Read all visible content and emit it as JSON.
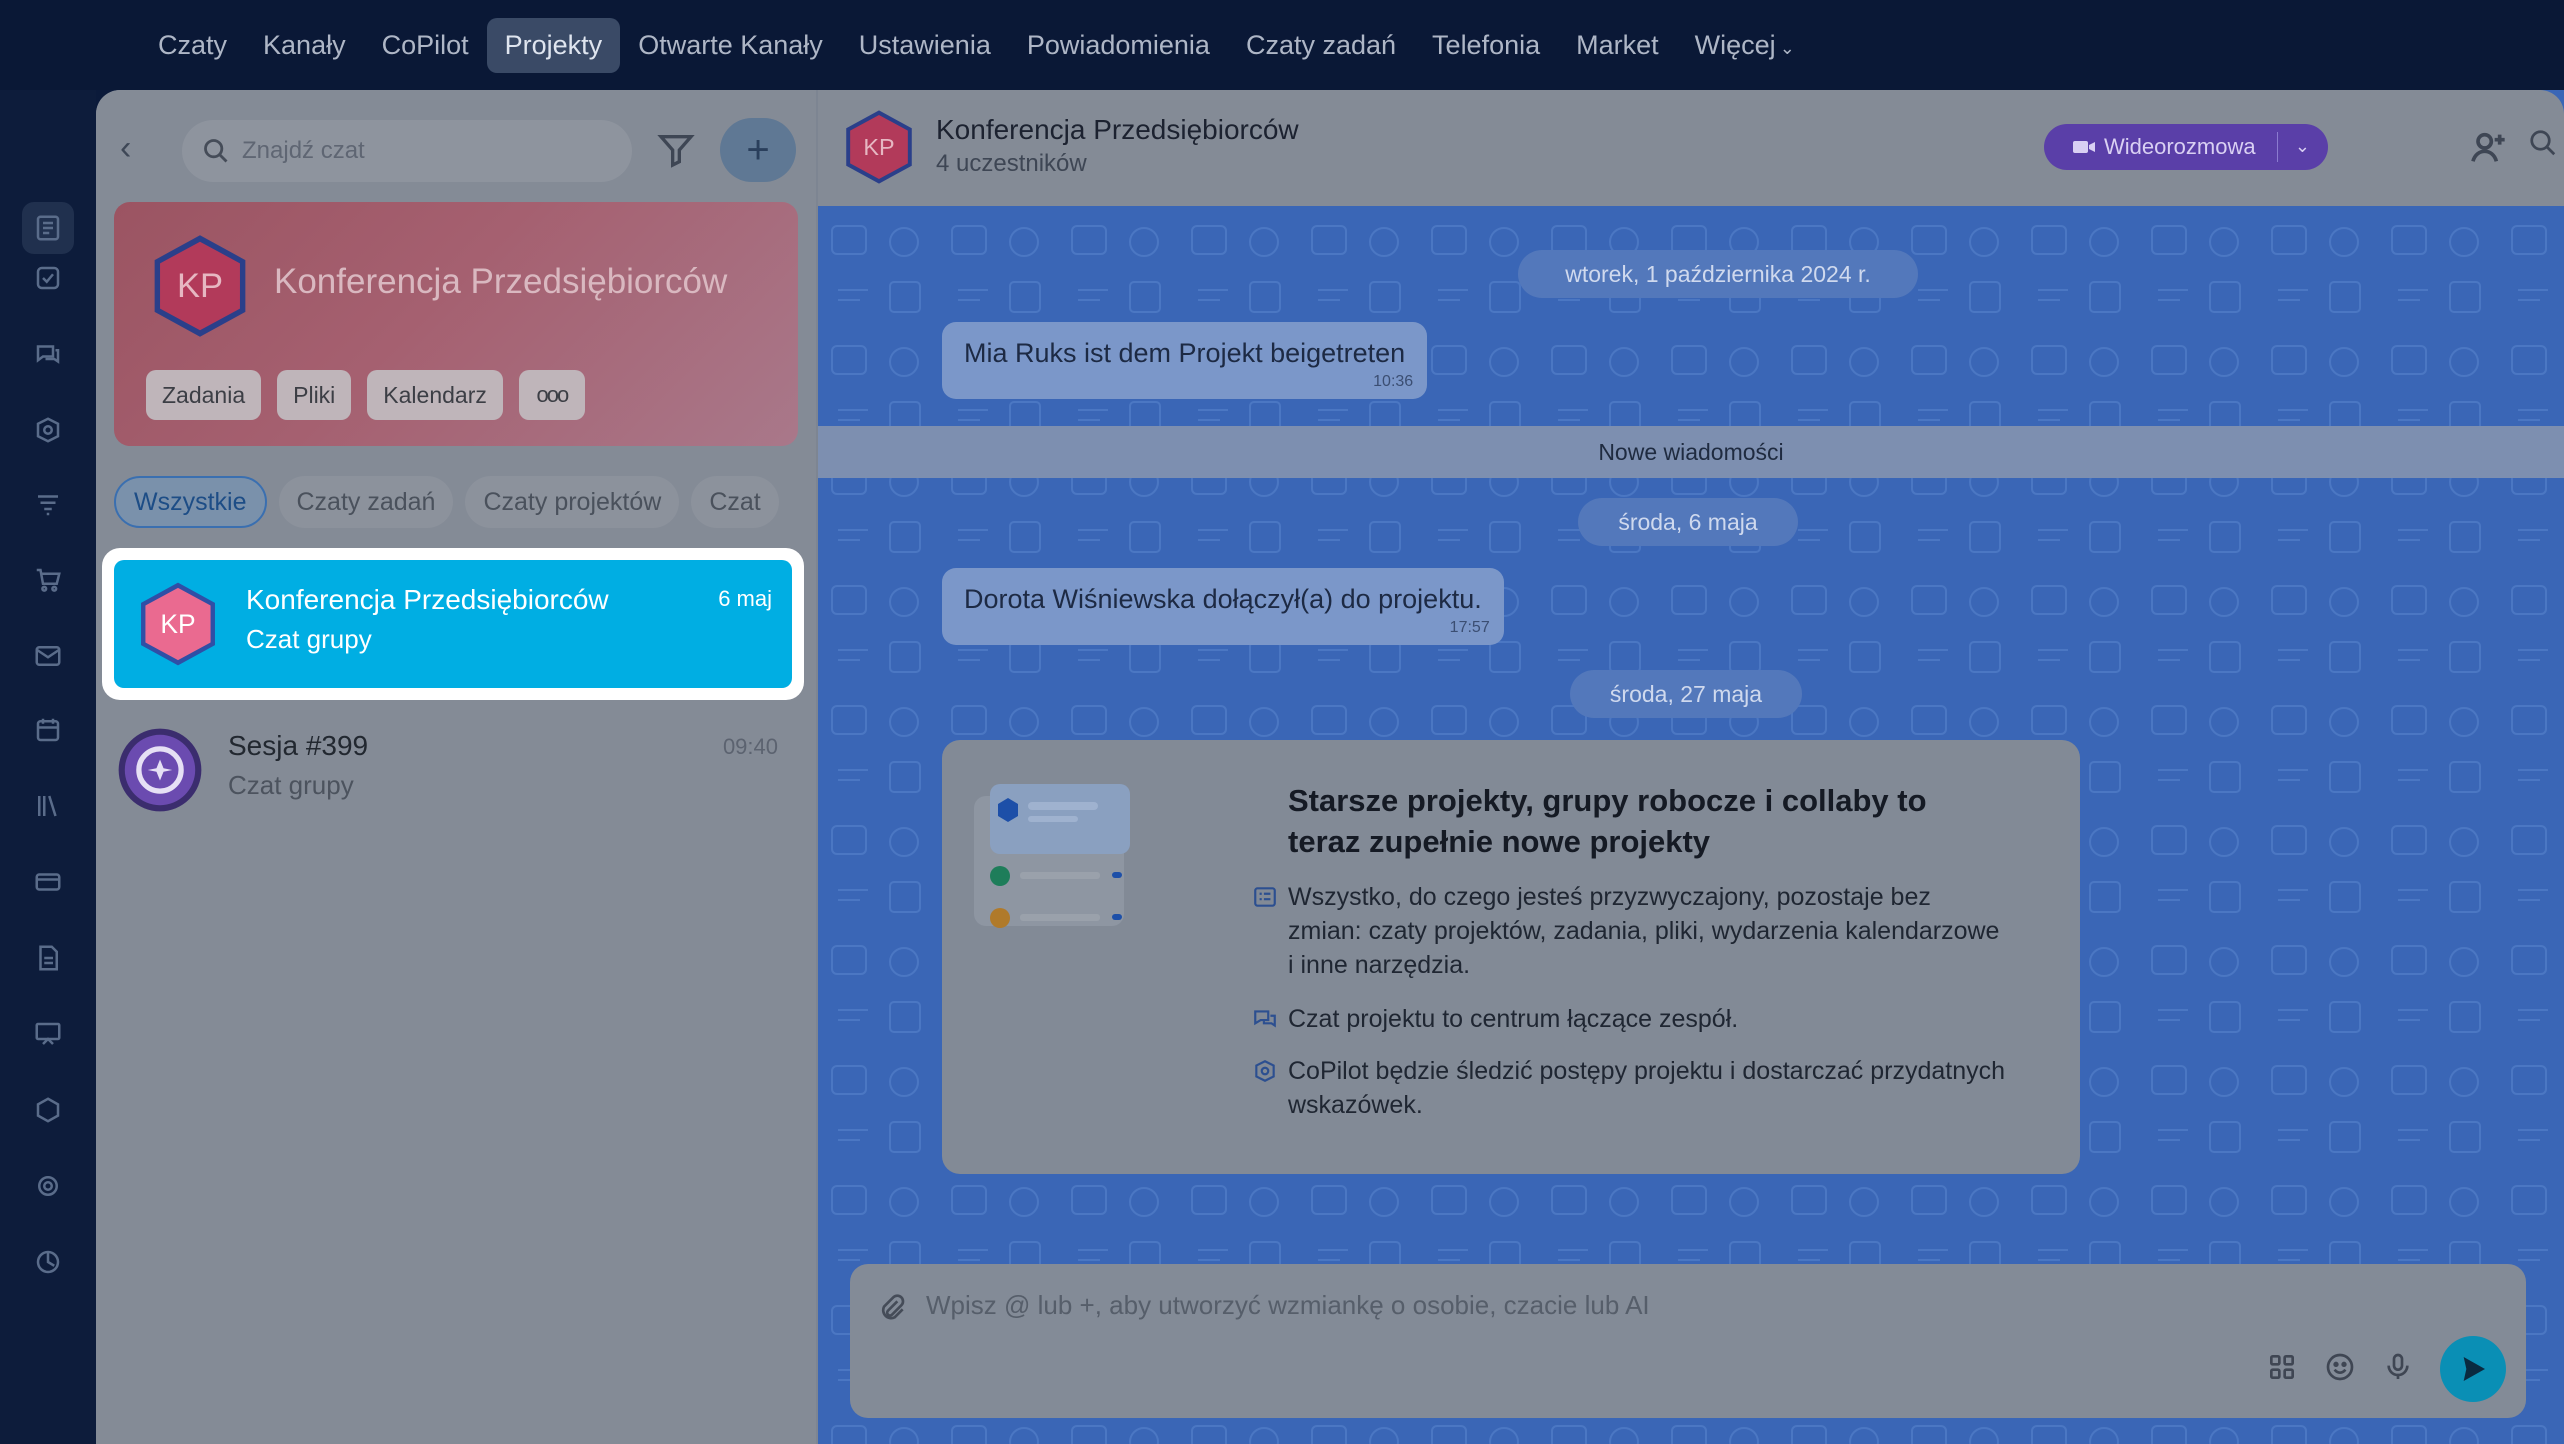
{
  "topnav": {
    "items": [
      {
        "label": "Czaty"
      },
      {
        "label": "Kanały"
      },
      {
        "label": "CoPilot"
      },
      {
        "label": "Projekty"
      },
      {
        "label": "Otwarte Kanały"
      },
      {
        "label": "Ustawienia"
      },
      {
        "label": "Powiadomienia"
      },
      {
        "label": "Czaty zadań"
      },
      {
        "label": "Telefonia"
      },
      {
        "label": "Market"
      },
      {
        "label": "Więcej"
      }
    ],
    "active_index": 3
  },
  "sidebar": {
    "search_placeholder": "Znajdź czat",
    "banner": {
      "initials": "KP",
      "title": "Konferencja Przedsiębiorców",
      "buttons": [
        "Zadania",
        "Pliki",
        "Kalendarz"
      ],
      "more": "ooo"
    },
    "filters": [
      "Wszystkie",
      "Czaty zadań",
      "Czaty projektów",
      "Czat"
    ],
    "chats": [
      {
        "initials": "KP",
        "title": "Konferencja Przedsiębiorców",
        "subtitle": "Czat grupy",
        "time": "6 maj",
        "selected": true
      },
      {
        "title": "Sesja #399",
        "subtitle": "Czat grupy",
        "time": "09:40",
        "selected": false
      }
    ]
  },
  "chat": {
    "header": {
      "initials": "KP",
      "title": "Konferencja Przedsiębiorców",
      "subtitle": "4 uczestników",
      "video_label": "Wideorozmowa"
    },
    "dates": [
      "wtorek, 1 października 2024 r.",
      "środa, 6 maja",
      "środa, 27 maja"
    ],
    "messages": [
      {
        "text": "Mia Ruks ist dem Projekt beigetreten",
        "time": "10:36"
      },
      {
        "text": "Dorota Wiśniewska dołączył(a) do projektu.",
        "time": "17:57"
      }
    ],
    "new_messages_label": "Nowe wiadomości",
    "info_card": {
      "title": "Starsze projekty, grupy robocze i collaby to teraz zupełnie nowe projekty",
      "rows": [
        "Wszystko, do czego jesteś przyzwyczajony, pozostaje bez zmian: czaty projektów, zadania, pliki, wydarzenia kalendarzowe i inne narzędzia.",
        "Czat projektu to centrum łączące zespół.",
        "CoPilot będzie śledzić postępy projektu i dostarczać przydatnych wskazówek."
      ]
    },
    "composer_placeholder": "Wpisz @ lub +, aby utworzyć wzmiankę o osobie, czacie lub AI"
  },
  "colors": {
    "accent": "#00aee3",
    "chat_bg": "#3a66b6",
    "video_button": "#5a3fa8",
    "project_avatar": "#e0527a"
  }
}
